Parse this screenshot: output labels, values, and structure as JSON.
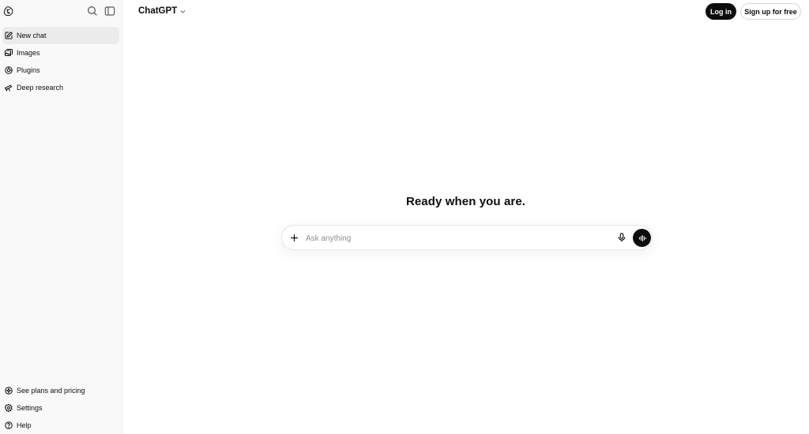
{
  "sidebar": {
    "top_icons": [
      "openai-logo-icon",
      "search-icon",
      "sidebar-toggle-icon"
    ],
    "items": [
      {
        "label": "New chat",
        "icon": "edit-icon",
        "active": true
      },
      {
        "label": "Images",
        "icon": "images-icon",
        "active": false
      },
      {
        "label": "Plugins",
        "icon": "plugins-icon",
        "active": false
      },
      {
        "label": "Deep research",
        "icon": "telescope-icon",
        "active": false
      }
    ],
    "bottom_items": [
      {
        "label": "See plans and pricing",
        "icon": "sparkle-badge-icon"
      },
      {
        "label": "Settings",
        "icon": "gear-icon"
      },
      {
        "label": "Help",
        "icon": "help-icon"
      }
    ]
  },
  "header": {
    "model_label": "ChatGPT",
    "login_label": "Log in",
    "signup_label": "Sign up for free"
  },
  "main": {
    "heading": "Ready when you are.",
    "composer": {
      "placeholder": "Ask anything",
      "value": ""
    }
  },
  "colors": {
    "sidebar_bg": "#f9f9f9",
    "active_item_bg": "#ececec",
    "primary_button_bg": "#0d0d0d",
    "text": "#0d0d0d",
    "placeholder": "#8f8f8f"
  }
}
